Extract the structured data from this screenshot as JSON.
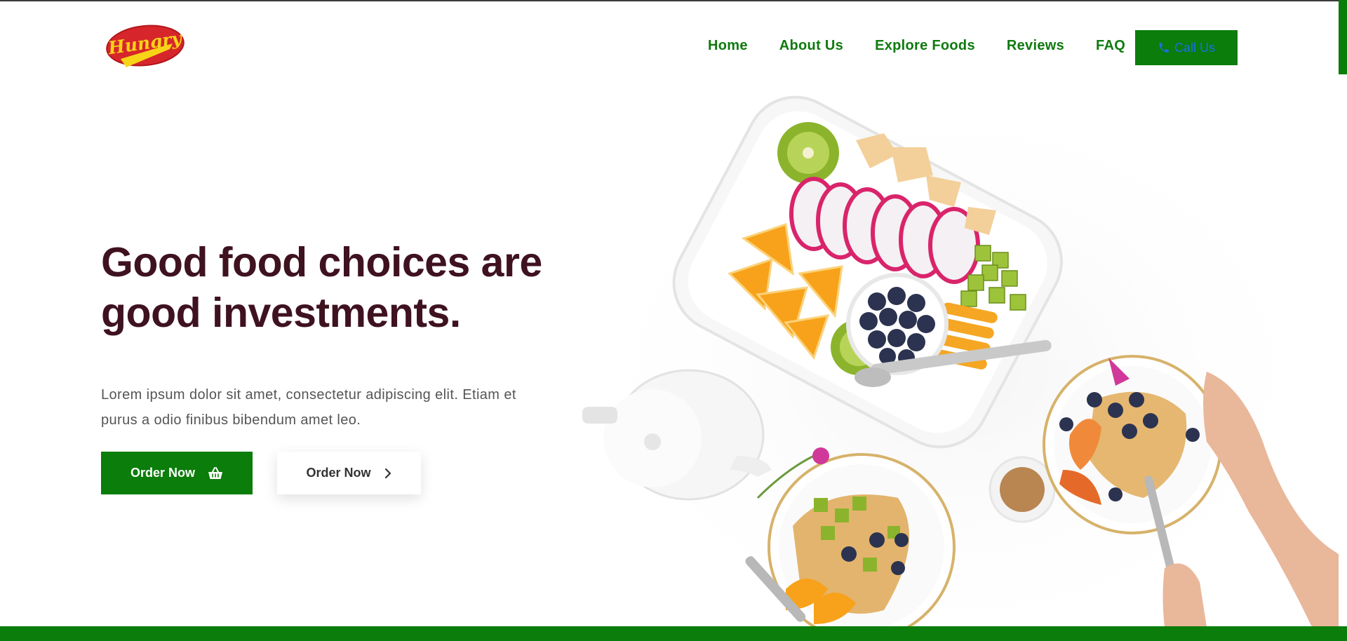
{
  "brand": {
    "logo_text": "Hungry",
    "logo_colors": {
      "oval": "#d7262b",
      "text": "#f7d417",
      "swoosh": "#f7d417"
    }
  },
  "nav": {
    "items": [
      {
        "label": "Home"
      },
      {
        "label": "About Us"
      },
      {
        "label": "Explore Foods"
      },
      {
        "label": "Reviews"
      },
      {
        "label": "FAQ"
      }
    ],
    "call_button": {
      "label": "Call Us",
      "icon": "phone-icon"
    }
  },
  "hero": {
    "headline_line1": "Good food choices are",
    "headline_line2": "good investments.",
    "description_line1": "Lorem ipsum dolor sit amet, consectetur adipiscing elit. Etiam et",
    "description_line2": "purus a odio finibus bibendum amet leo.",
    "primary_button": {
      "label": "Order Now",
      "icon": "basket-icon"
    },
    "secondary_button": {
      "label": "Order Now",
      "icon": "chevron-right-icon"
    },
    "image_alt": "Breakfast table with fruit platter, blueberries, crepes and coffee"
  },
  "colors": {
    "accent_green": "#0a7d0a",
    "headline": "#3f1220",
    "body_text": "#555555",
    "call_text": "#1a6fe8"
  }
}
